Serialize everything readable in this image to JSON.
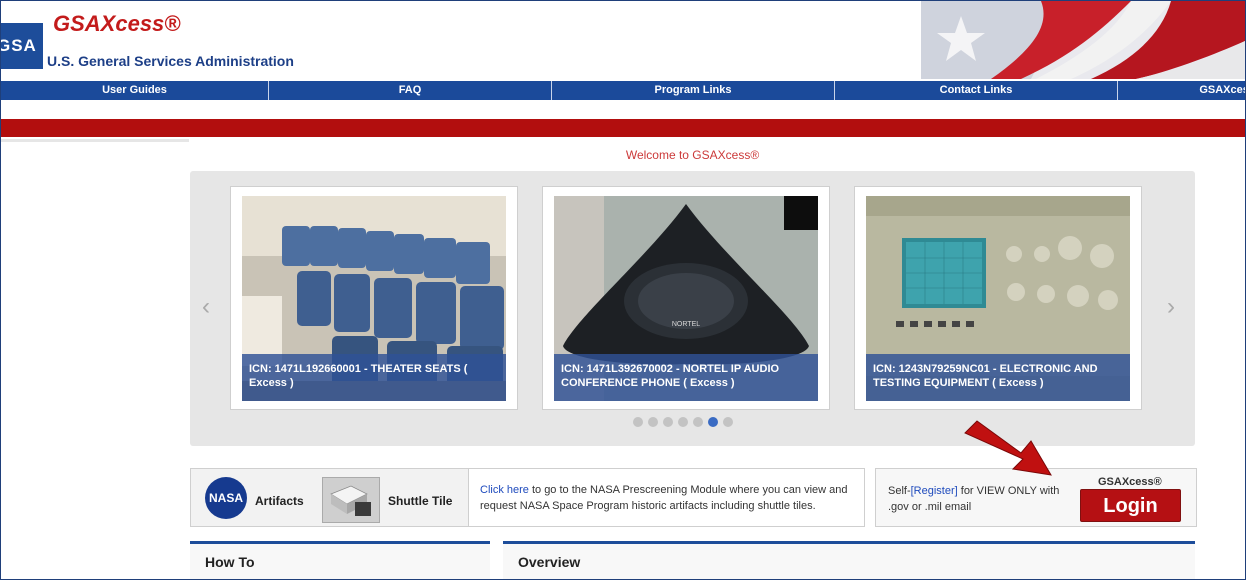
{
  "header": {
    "logo_text": "GSA",
    "brand": "GSAXcess®",
    "agency": "U.S. General Services Administration"
  },
  "nav": {
    "items": [
      "User Guides",
      "FAQ",
      "Program Links",
      "Contact Links",
      "GSAXcess"
    ]
  },
  "welcome": "Welcome to GSAXcess®",
  "carousel": {
    "items": [
      {
        "caption": "ICN: 1471L192660001 - THEATER SEATS ( Excess )"
      },
      {
        "caption": "ICN: 1471L392670002 - NORTEL IP AUDIO CONFERENCE PHONE ( Excess )"
      },
      {
        "caption": "ICN: 1243N79259NC01 - ELECTRONIC AND TESTING EQUIPMENT ( Excess )"
      }
    ],
    "prev_icon": "‹",
    "next_icon": "›",
    "dot_count": 7,
    "active_dot": 6
  },
  "nasa": {
    "logo_text": "NASA",
    "artifacts_label": "Artifacts",
    "shuttle_label": "Shuttle Tile",
    "link_text": "Click here",
    "description": " to go to the NASA Prescreening Module where you can view and request NASA Space Program historic artifacts including shuttle tiles."
  },
  "login": {
    "self_prefix": "Self-",
    "register_link": "[Register]",
    "self_suffix": " for VIEW ONLY with .gov or .mil email",
    "label": "GSAXcess®",
    "button": "Login"
  },
  "panels": {
    "how_to": "How To",
    "overview": "Overview"
  },
  "colors": {
    "nav_blue": "#1b4a9a",
    "bar_red": "#b20e0e",
    "login_red": "#b51013"
  }
}
